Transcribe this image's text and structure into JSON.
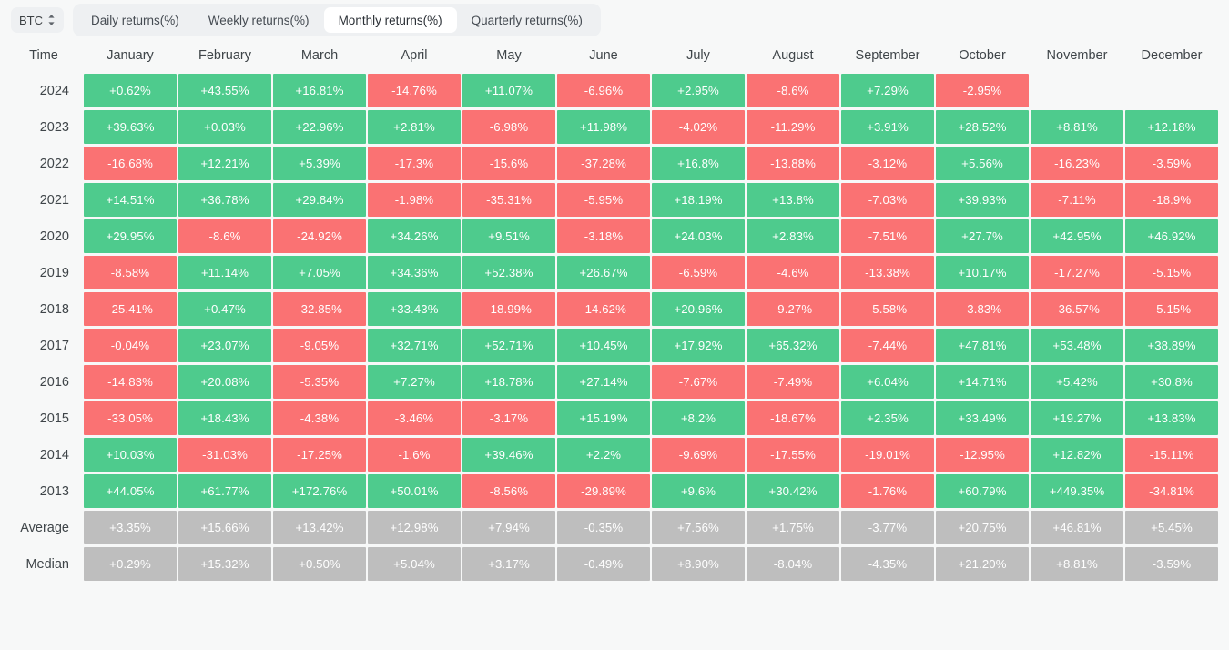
{
  "toolbar": {
    "symbol": "BTC",
    "symbol_icon": "chevron-up-down-icon",
    "tabs": [
      {
        "label": "Daily returns(%)",
        "active": false
      },
      {
        "label": "Weekly returns(%)",
        "active": false
      },
      {
        "label": "Monthly returns(%)",
        "active": true
      },
      {
        "label": "Quarterly returns(%)",
        "active": false
      }
    ]
  },
  "colors": {
    "positive": "#4ecb8d",
    "negative": "#fa7273",
    "stat": "#bebebe",
    "background": "#f7f8f8",
    "tabbar": "#eef0f2",
    "tab_active": "#ffffff",
    "text": "#3f4549"
  },
  "chart_data": {
    "type": "heatmap",
    "title": "Monthly returns(%)",
    "xlabel": "",
    "ylabel": "Time",
    "legend": "",
    "grid": false,
    "columns": [
      "Time",
      "January",
      "February",
      "March",
      "April",
      "May",
      "June",
      "July",
      "August",
      "September",
      "October",
      "November",
      "December"
    ],
    "categories": [
      "January",
      "February",
      "March",
      "April",
      "May",
      "June",
      "July",
      "August",
      "September",
      "October",
      "November",
      "December"
    ],
    "rows": [
      {
        "label": "2024",
        "kind": "year",
        "values": [
          "+0.62%",
          "+43.55%",
          "+16.81%",
          "-14.76%",
          "+11.07%",
          "-6.96%",
          "+2.95%",
          "-8.6%",
          "+7.29%",
          "-2.95%",
          "",
          ""
        ],
        "numeric": [
          0.62,
          43.55,
          16.81,
          -14.76,
          11.07,
          -6.96,
          2.95,
          -8.6,
          7.29,
          -2.95,
          null,
          null
        ]
      },
      {
        "label": "2023",
        "kind": "year",
        "values": [
          "+39.63%",
          "+0.03%",
          "+22.96%",
          "+2.81%",
          "-6.98%",
          "+11.98%",
          "-4.02%",
          "-11.29%",
          "+3.91%",
          "+28.52%",
          "+8.81%",
          "+12.18%"
        ],
        "numeric": [
          39.63,
          0.03,
          22.96,
          2.81,
          -6.98,
          11.98,
          -4.02,
          -11.29,
          3.91,
          28.52,
          8.81,
          12.18
        ]
      },
      {
        "label": "2022",
        "kind": "year",
        "values": [
          "-16.68%",
          "+12.21%",
          "+5.39%",
          "-17.3%",
          "-15.6%",
          "-37.28%",
          "+16.8%",
          "-13.88%",
          "-3.12%",
          "+5.56%",
          "-16.23%",
          "-3.59%"
        ],
        "numeric": [
          -16.68,
          12.21,
          5.39,
          -17.3,
          -15.6,
          -37.28,
          16.8,
          -13.88,
          -3.12,
          5.56,
          -16.23,
          -3.59
        ]
      },
      {
        "label": "2021",
        "kind": "year",
        "values": [
          "+14.51%",
          "+36.78%",
          "+29.84%",
          "-1.98%",
          "-35.31%",
          "-5.95%",
          "+18.19%",
          "+13.8%",
          "-7.03%",
          "+39.93%",
          "-7.11%",
          "-18.9%"
        ],
        "numeric": [
          14.51,
          36.78,
          29.84,
          -1.98,
          -35.31,
          -5.95,
          18.19,
          13.8,
          -7.03,
          39.93,
          -7.11,
          -18.9
        ]
      },
      {
        "label": "2020",
        "kind": "year",
        "values": [
          "+29.95%",
          "-8.6%",
          "-24.92%",
          "+34.26%",
          "+9.51%",
          "-3.18%",
          "+24.03%",
          "+2.83%",
          "-7.51%",
          "+27.7%",
          "+42.95%",
          "+46.92%"
        ],
        "numeric": [
          29.95,
          -8.6,
          -24.92,
          34.26,
          9.51,
          -3.18,
          24.03,
          2.83,
          -7.51,
          27.7,
          42.95,
          46.92
        ]
      },
      {
        "label": "2019",
        "kind": "year",
        "values": [
          "-8.58%",
          "+11.14%",
          "+7.05%",
          "+34.36%",
          "+52.38%",
          "+26.67%",
          "-6.59%",
          "-4.6%",
          "-13.38%",
          "+10.17%",
          "-17.27%",
          "-5.15%"
        ],
        "numeric": [
          -8.58,
          11.14,
          7.05,
          34.36,
          52.38,
          26.67,
          -6.59,
          -4.6,
          -13.38,
          10.17,
          -17.27,
          -5.15
        ]
      },
      {
        "label": "2018",
        "kind": "year",
        "values": [
          "-25.41%",
          "+0.47%",
          "-32.85%",
          "+33.43%",
          "-18.99%",
          "-14.62%",
          "+20.96%",
          "-9.27%",
          "-5.58%",
          "-3.83%",
          "-36.57%",
          "-5.15%"
        ],
        "numeric": [
          -25.41,
          0.47,
          -32.85,
          33.43,
          -18.99,
          -14.62,
          20.96,
          -9.27,
          -5.58,
          -3.83,
          -36.57,
          -5.15
        ]
      },
      {
        "label": "2017",
        "kind": "year",
        "values": [
          "-0.04%",
          "+23.07%",
          "-9.05%",
          "+32.71%",
          "+52.71%",
          "+10.45%",
          "+17.92%",
          "+65.32%",
          "-7.44%",
          "+47.81%",
          "+53.48%",
          "+38.89%"
        ],
        "numeric": [
          -0.04,
          23.07,
          -9.05,
          32.71,
          52.71,
          10.45,
          17.92,
          65.32,
          -7.44,
          47.81,
          53.48,
          38.89
        ]
      },
      {
        "label": "2016",
        "kind": "year",
        "values": [
          "-14.83%",
          "+20.08%",
          "-5.35%",
          "+7.27%",
          "+18.78%",
          "+27.14%",
          "-7.67%",
          "-7.49%",
          "+6.04%",
          "+14.71%",
          "+5.42%",
          "+30.8%"
        ],
        "numeric": [
          -14.83,
          20.08,
          -5.35,
          7.27,
          18.78,
          27.14,
          -7.67,
          -7.49,
          6.04,
          14.71,
          5.42,
          30.8
        ]
      },
      {
        "label": "2015",
        "kind": "year",
        "values": [
          "-33.05%",
          "+18.43%",
          "-4.38%",
          "-3.46%",
          "-3.17%",
          "+15.19%",
          "+8.2%",
          "-18.67%",
          "+2.35%",
          "+33.49%",
          "+19.27%",
          "+13.83%"
        ],
        "numeric": [
          -33.05,
          18.43,
          -4.38,
          -3.46,
          -3.17,
          15.19,
          8.2,
          -18.67,
          2.35,
          33.49,
          19.27,
          13.83
        ]
      },
      {
        "label": "2014",
        "kind": "year",
        "values": [
          "+10.03%",
          "-31.03%",
          "-17.25%",
          "-1.6%",
          "+39.46%",
          "+2.2%",
          "-9.69%",
          "-17.55%",
          "-19.01%",
          "-12.95%",
          "+12.82%",
          "-15.11%"
        ],
        "numeric": [
          10.03,
          -31.03,
          -17.25,
          -1.6,
          39.46,
          2.2,
          -9.69,
          -17.55,
          -19.01,
          -12.95,
          12.82,
          -15.11
        ]
      },
      {
        "label": "2013",
        "kind": "year",
        "values": [
          "+44.05%",
          "+61.77%",
          "+172.76%",
          "+50.01%",
          "-8.56%",
          "-29.89%",
          "+9.6%",
          "+30.42%",
          "-1.76%",
          "+60.79%",
          "+449.35%",
          "-34.81%"
        ],
        "numeric": [
          44.05,
          61.77,
          172.76,
          50.01,
          -8.56,
          -29.89,
          9.6,
          30.42,
          -1.76,
          60.79,
          449.35,
          -34.81
        ]
      },
      {
        "label": "Average",
        "kind": "stat",
        "values": [
          "+3.35%",
          "+15.66%",
          "+13.42%",
          "+12.98%",
          "+7.94%",
          "-0.35%",
          "+7.56%",
          "+1.75%",
          "-3.77%",
          "+20.75%",
          "+46.81%",
          "+5.45%"
        ],
        "numeric": [
          3.35,
          15.66,
          13.42,
          12.98,
          7.94,
          -0.35,
          7.56,
          1.75,
          -3.77,
          20.75,
          46.81,
          5.45
        ]
      },
      {
        "label": "Median",
        "kind": "stat",
        "values": [
          "+0.29%",
          "+15.32%",
          "+0.50%",
          "+5.04%",
          "+3.17%",
          "-0.49%",
          "+8.90%",
          "-8.04%",
          "-4.35%",
          "+21.20%",
          "+8.81%",
          "-3.59%"
        ],
        "numeric": [
          0.29,
          15.32,
          0.5,
          5.04,
          3.17,
          -0.49,
          8.9,
          -8.04,
          -4.35,
          21.2,
          8.81,
          -3.59
        ]
      }
    ]
  }
}
